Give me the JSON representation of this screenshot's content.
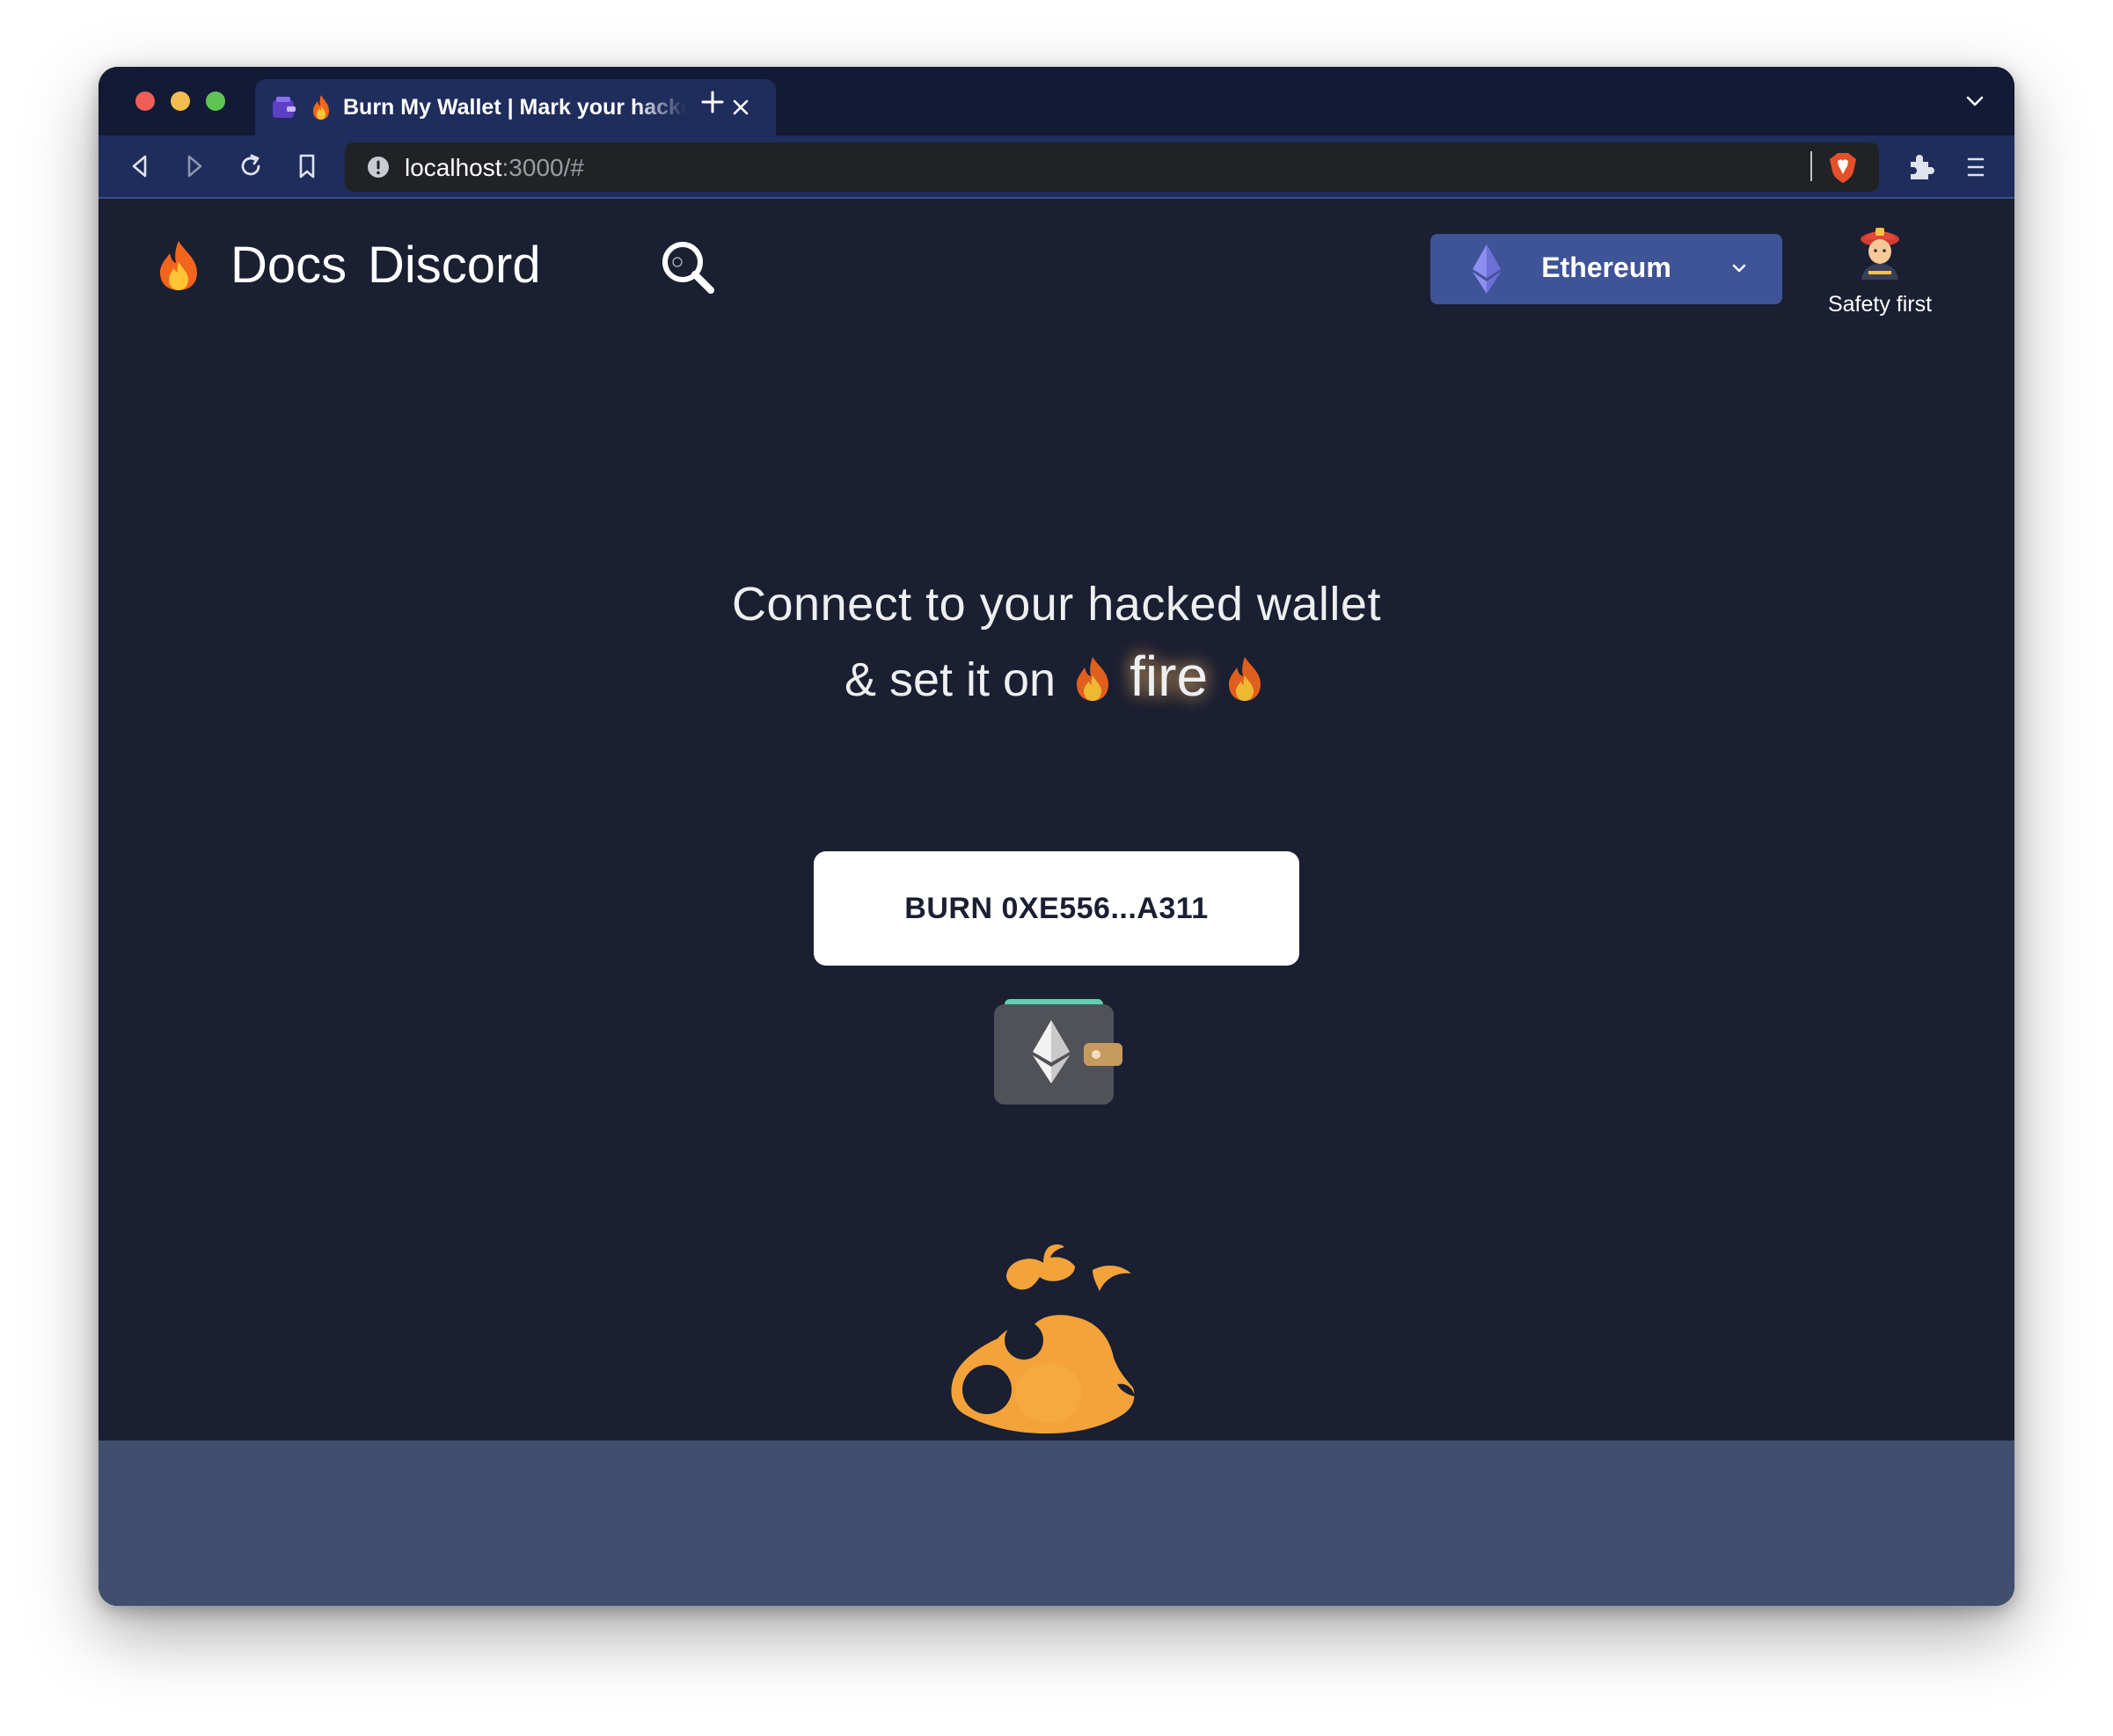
{
  "browser": {
    "tab": {
      "title": "Burn My Wallet | Mark your hacked wallet"
    },
    "url": {
      "host": "localhost",
      "rest": ":3000/#"
    }
  },
  "nav": {
    "links": [
      {
        "label": "Docs"
      },
      {
        "label": "Discord"
      }
    ]
  },
  "network": {
    "selected": "Ethereum"
  },
  "safety": {
    "label": "Safety first"
  },
  "hero": {
    "headline": "Connect to your hacked wallet",
    "subline_prefix": "& set it on",
    "subline_word": "fire"
  },
  "burn": {
    "label": "BURN 0XE556...A311"
  },
  "colors": {
    "page_bg": "#1a1f32",
    "tab_bar": "#121a36",
    "toolbar": "#1f2d5c",
    "network_select": "#3e5496",
    "ground": "#404f6d",
    "flame": "#f3a33a"
  },
  "icons": {
    "tab_favicon": "wallet-icon",
    "nav_logo": "fire-icon",
    "search": "search-icon",
    "network": "ethereum-icon",
    "safety": "firefighter-icon",
    "wallet": "eth-wallet-icon",
    "mascot": "flame-mascot-icon"
  }
}
